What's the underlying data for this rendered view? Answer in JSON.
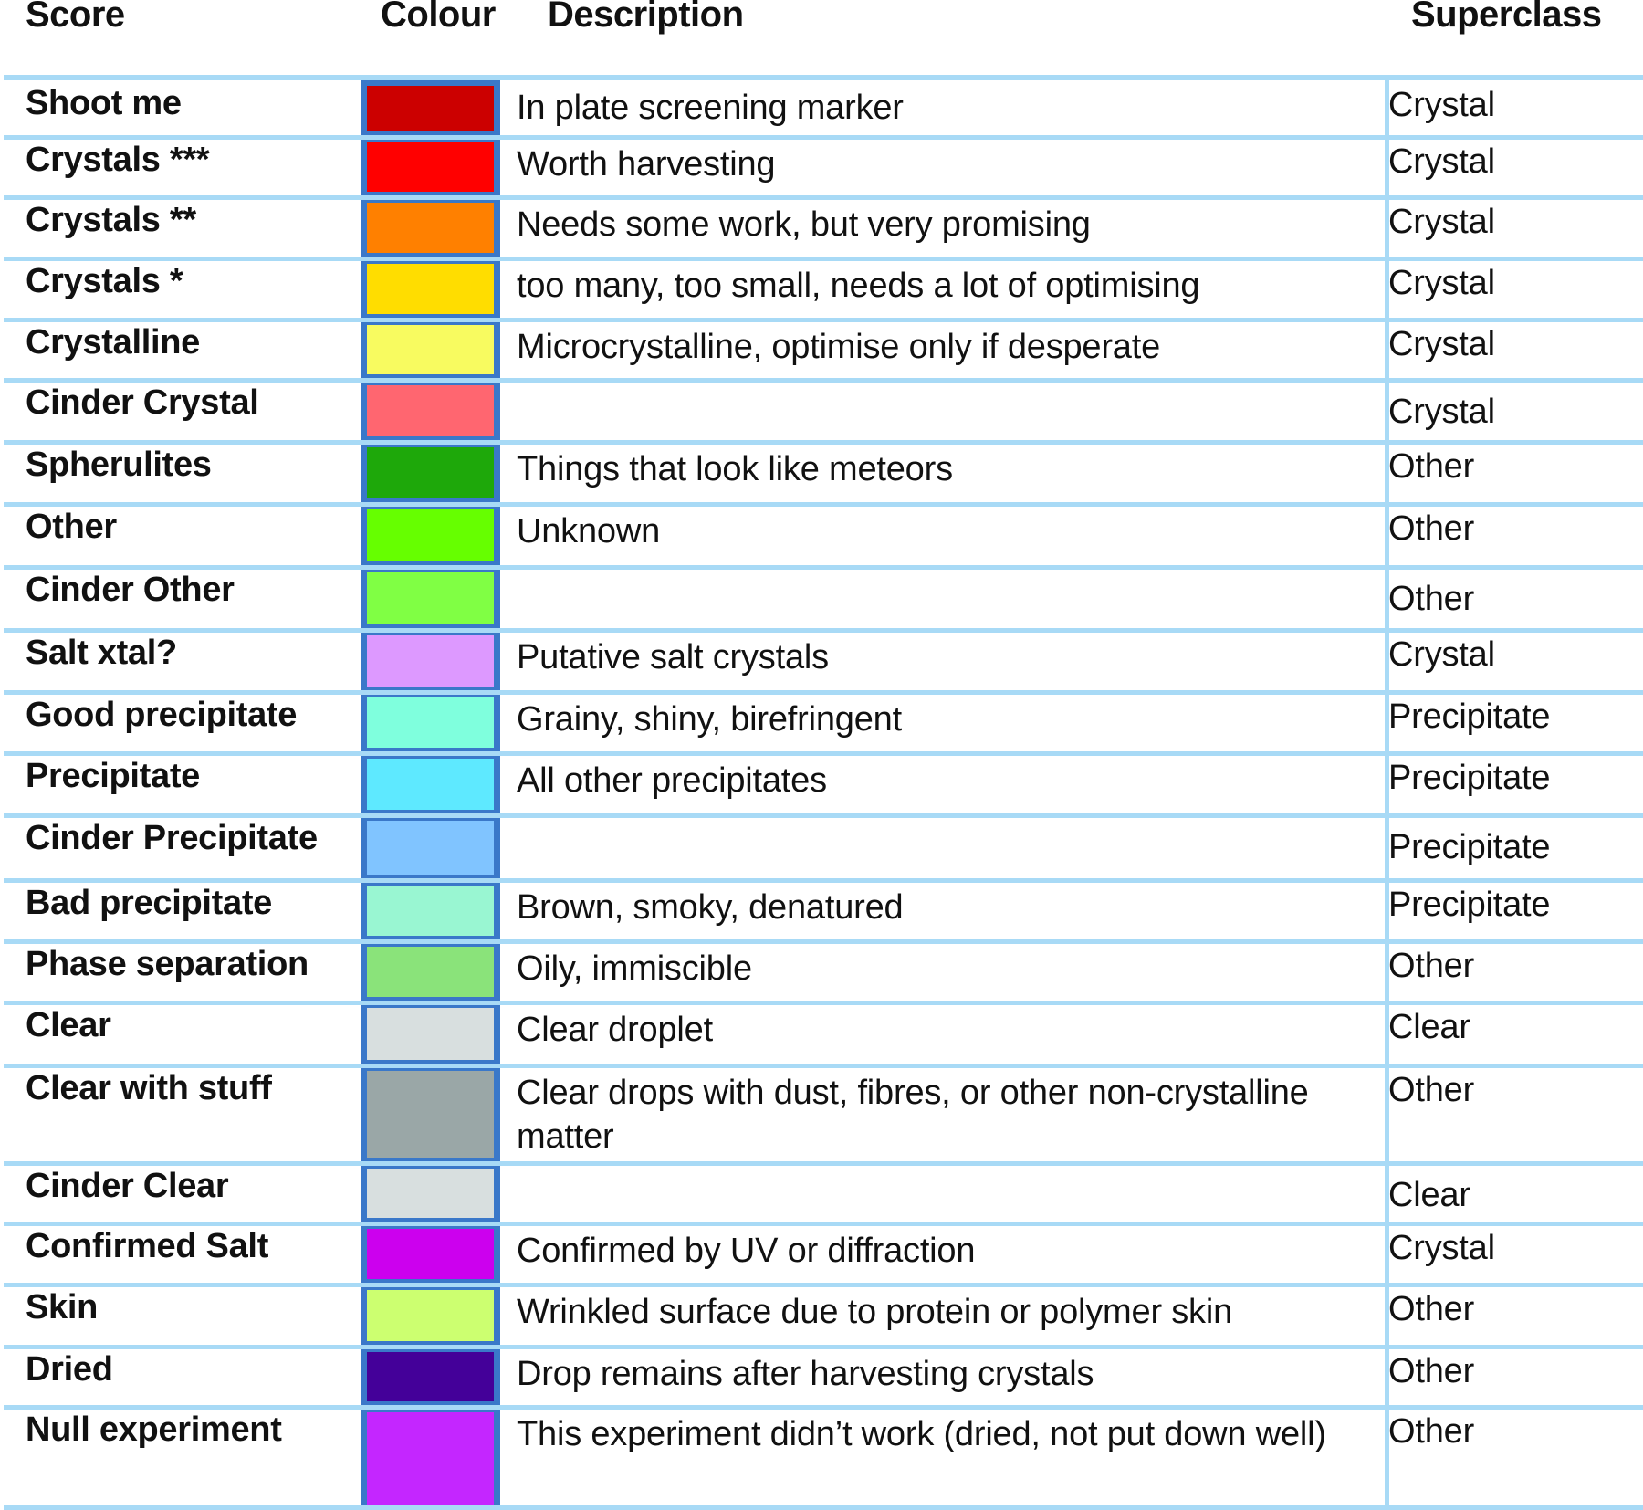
{
  "table": {
    "headers": {
      "score": "Score",
      "colour": "Colour",
      "description": "Description",
      "superclass": "Superclass"
    },
    "rows": [
      {
        "score": "Shoot me",
        "colour": "#cc0000",
        "description": "In plate screening marker",
        "superclass": "Crystal"
      },
      {
        "score": "Crystals ***",
        "colour": "#ff0000",
        "description": "Worth harvesting",
        "superclass": "Crystal"
      },
      {
        "score": "Crystals **",
        "colour": "#ff8000",
        "description": "Needs some work, but very promising",
        "superclass": "Crystal"
      },
      {
        "score": "Crystals *",
        "colour": "#ffdd00",
        "description": "too many, too small, needs a lot of optimising",
        "superclass": "Crystal"
      },
      {
        "score": "Crystalline",
        "colour": "#f8fb60",
        "description": "Microcrystalline, optimise only if desperate",
        "superclass": "Crystal"
      },
      {
        "score": "Cinder Crystal",
        "colour": "#ff6670",
        "description": "",
        "superclass": "Crystal"
      },
      {
        "score": "Spherulites",
        "colour": "#1ea80a",
        "description": "Things that look like meteors",
        "superclass": "Other"
      },
      {
        "score": "Other",
        "colour": "#66ff00",
        "description": "Unknown",
        "superclass": "Other"
      },
      {
        "score": "Cinder Other",
        "colour": "#80ff44",
        "description": "",
        "superclass": "Other"
      },
      {
        "score": "Salt xtal?",
        "colour": "#dd99ff",
        "description": "Putative salt crystals",
        "superclass": "Crystal"
      },
      {
        "score": "Good precipitate",
        "colour": "#7fffdd",
        "description": "Grainy, shiny, birefringent",
        "superclass": "Precipitate"
      },
      {
        "score": "Precipitate",
        "colour": "#5ee9ff",
        "description": "All other precipitates",
        "superclass": "Precipitate"
      },
      {
        "score": "Cinder Precipitate",
        "colour": "#80c4ff",
        "description": "",
        "superclass": "Precipitate"
      },
      {
        "score": "Bad precipitate",
        "colour": "#99f6d2",
        "description": "Brown, smoky, denatured",
        "superclass": "Precipitate"
      },
      {
        "score": "Phase separation",
        "colour": "#8ae37a",
        "description": "Oily, immiscible",
        "superclass": "Other"
      },
      {
        "score": "Clear",
        "colour": "#d8dfdf",
        "description": "Clear droplet",
        "superclass": "Clear"
      },
      {
        "score": "Clear with stuff",
        "colour": "#9aa7a7",
        "description": "Clear drops with dust, fibres, or other non-crystalline matter",
        "superclass": "Other"
      },
      {
        "score": "Cinder Clear",
        "colour": "#d8dfdf",
        "description": "",
        "superclass": "Clear"
      },
      {
        "score": "Confirmed Salt",
        "colour": "#cc00ee",
        "description": "Confirmed by UV or diffraction",
        "superclass": "Crystal"
      },
      {
        "score": "Skin",
        "colour": "#ccff70",
        "description": "Wrinkled surface due to protein or polymer skin",
        "superclass": "Other"
      },
      {
        "score": "Dried",
        "colour": "#440099",
        "description": "Drop remains after harvesting crystals",
        "superclass": "Other"
      },
      {
        "score": "Null experiment",
        "colour": "#c426ff",
        "description": "This experiment didn’t work (dried, not put down well)",
        "superclass": "Other"
      }
    ]
  }
}
